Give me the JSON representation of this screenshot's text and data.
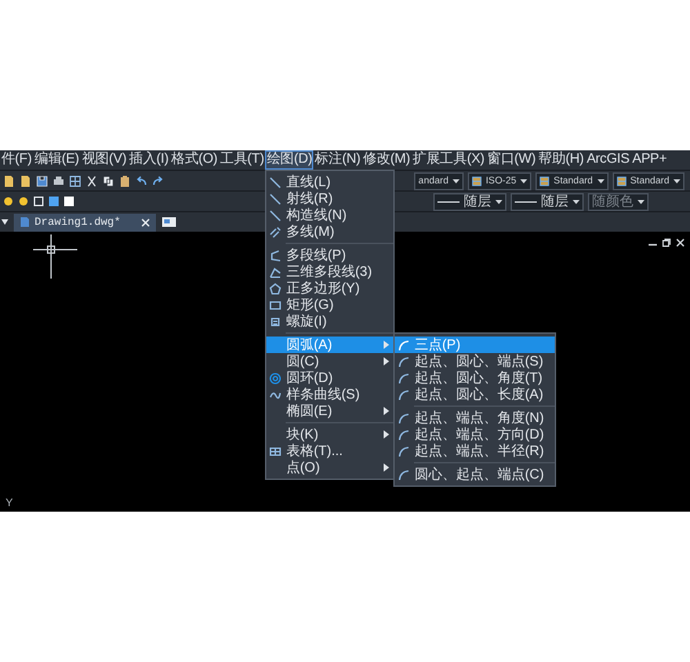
{
  "menubar": [
    {
      "label": "件(F)",
      "selected": false
    },
    {
      "label": "编辑(E)",
      "selected": false
    },
    {
      "label": "视图(V)",
      "selected": false
    },
    {
      "label": "插入(I)",
      "selected": false
    },
    {
      "label": "格式(O)",
      "selected": false
    },
    {
      "label": "工具(T)",
      "selected": false
    },
    {
      "label": "绘图(D)",
      "selected": true
    },
    {
      "label": "标注(N)",
      "selected": false
    },
    {
      "label": "修改(M)",
      "selected": false
    },
    {
      "label": "扩展工具(X)",
      "selected": false
    },
    {
      "label": "窗口(W)",
      "selected": false
    },
    {
      "label": "帮助(H)",
      "selected": false
    },
    {
      "label": "ArcGIS",
      "selected": false
    },
    {
      "label": "APP+",
      "selected": false
    }
  ],
  "toolbar": {
    "style_fields": [
      {
        "text": "andard",
        "kind": "plain"
      },
      {
        "text": "ISO-25",
        "kind": "dimstyle"
      },
      {
        "text": "Standard",
        "kind": "tablestyle"
      },
      {
        "text": "Standard",
        "kind": "leaderstyle"
      }
    ],
    "property_fields": [
      {
        "text": "随层",
        "kind": "line",
        "disabled": false
      },
      {
        "text": "随层",
        "kind": "line",
        "disabled": false
      },
      {
        "text": "随颜色",
        "kind": "plain",
        "disabled": true
      }
    ]
  },
  "tab": {
    "label": "Drawing1.dwg*"
  },
  "draw_menu": {
    "groups": [
      {
        "items": [
          {
            "label": "直线(L)",
            "kind": "line",
            "has_submenu": false,
            "selected": false
          },
          {
            "label": "射线(R)",
            "kind": "line",
            "has_submenu": false,
            "selected": false
          },
          {
            "label": "构造线(N)",
            "kind": "line",
            "has_submenu": false,
            "selected": false
          },
          {
            "label": "多线(M)",
            "kind": "multiline",
            "has_submenu": false,
            "selected": false
          }
        ]
      },
      {
        "items": [
          {
            "label": "多段线(P)",
            "kind": "polyline",
            "has_submenu": false,
            "selected": false
          },
          {
            "label": "三维多段线(3)",
            "kind": "polyline3d",
            "has_submenu": false,
            "selected": false
          },
          {
            "label": "正多边形(Y)",
            "kind": "polygon",
            "has_submenu": false,
            "selected": false
          },
          {
            "label": "矩形(G)",
            "kind": "rect",
            "has_submenu": false,
            "selected": false
          },
          {
            "label": "螺旋(I)",
            "kind": "helix",
            "has_submenu": false,
            "selected": false
          }
        ]
      },
      {
        "items": [
          {
            "label": "圆弧(A)",
            "kind": "none",
            "has_submenu": true,
            "selected": true,
            "submenu": {
              "groups": [
                {
                  "items": [
                    {
                      "label": "三点(P)",
                      "selected": true
                    },
                    {
                      "label": "起点、圆心、端点(S)",
                      "selected": false
                    },
                    {
                      "label": "起点、圆心、角度(T)",
                      "selected": false
                    },
                    {
                      "label": "起点、圆心、长度(A)",
                      "selected": false
                    }
                  ]
                },
                {
                  "items": [
                    {
                      "label": "起点、端点、角度(N)",
                      "selected": false
                    },
                    {
                      "label": "起点、端点、方向(D)",
                      "selected": false
                    },
                    {
                      "label": "起点、端点、半径(R)",
                      "selected": false
                    }
                  ]
                },
                {
                  "items": [
                    {
                      "label": "圆心、起点、端点(C)",
                      "selected": false
                    }
                  ]
                }
              ]
            }
          },
          {
            "label": "圆(C)",
            "kind": "none",
            "has_submenu": true,
            "selected": false
          },
          {
            "label": "圆环(D)",
            "kind": "donut",
            "has_submenu": false,
            "selected": false
          },
          {
            "label": "样条曲线(S)",
            "kind": "spline",
            "has_submenu": false,
            "selected": false
          },
          {
            "label": "椭圆(E)",
            "kind": "none",
            "has_submenu": true,
            "selected": false
          }
        ]
      },
      {
        "items": [
          {
            "label": "块(K)",
            "kind": "none",
            "has_submenu": true,
            "selected": false
          },
          {
            "label": "表格(T)...",
            "kind": "table",
            "has_submenu": false,
            "selected": false
          },
          {
            "label": "点(O)",
            "kind": "none",
            "has_submenu": true,
            "selected": false
          }
        ]
      }
    ]
  },
  "canvas": {
    "axis_label": "Y"
  }
}
